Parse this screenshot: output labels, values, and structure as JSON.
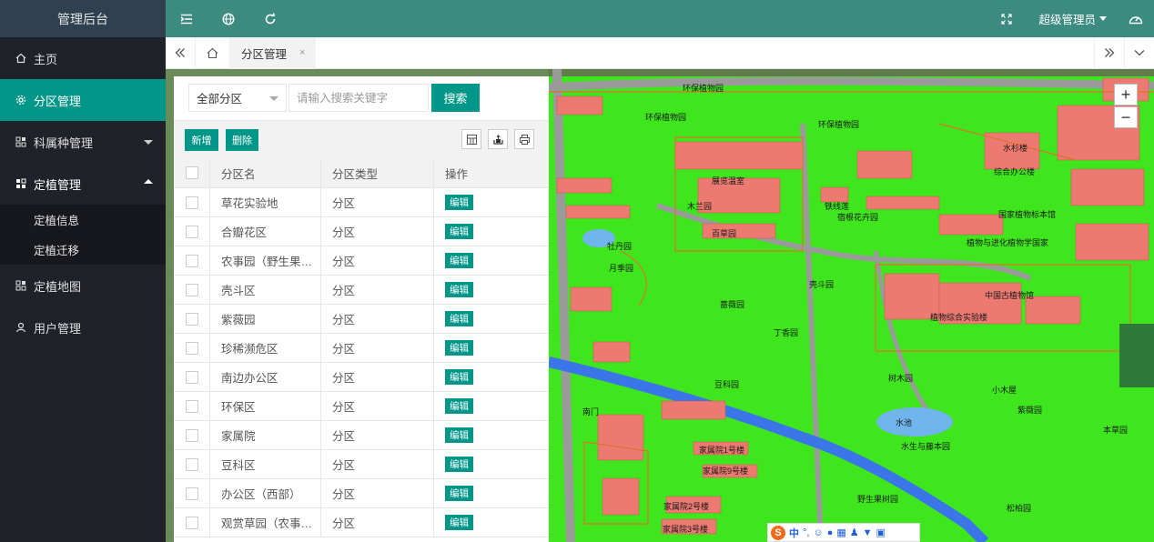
{
  "sidebar": {
    "brand": "管理后台",
    "items": [
      {
        "label": "主页",
        "icon": "home-icon"
      },
      {
        "label": "分区管理",
        "icon": "gear-icon",
        "active": true
      },
      {
        "label": "科属种管理",
        "icon": "apps-icon"
      },
      {
        "label": "定植管理",
        "icon": "apps-icon",
        "expanded": true
      },
      {
        "label": "定植地图",
        "icon": "apps-icon"
      },
      {
        "label": "用户管理",
        "icon": "user-icon"
      }
    ],
    "sub_items": [
      "定植信息",
      "定植迁移"
    ]
  },
  "topbar": {
    "user": "超级管理员",
    "icons": [
      "menu-collapse-icon",
      "globe-icon",
      "refresh-icon",
      "fullscreen-icon",
      "theme-icon"
    ]
  },
  "tabs": {
    "active": "分区管理",
    "close": "×"
  },
  "search": {
    "select_value": "全部分区",
    "placeholder": "请输入搜索关键字",
    "button": "搜索"
  },
  "toolbar": {
    "add": "新增",
    "delete": "删除"
  },
  "table": {
    "headers": [
      "分区名",
      "分区类型",
      "操作"
    ],
    "edit_label": "编辑",
    "rows": [
      {
        "name": "草花实验地",
        "type": "分区"
      },
      {
        "name": "合瓣花区",
        "type": "分区"
      },
      {
        "name": "农事园（野生果…",
        "type": "分区"
      },
      {
        "name": "壳斗区",
        "type": "分区"
      },
      {
        "name": "紫薇园",
        "type": "分区"
      },
      {
        "name": "珍稀濒危区",
        "type": "分区"
      },
      {
        "name": "南边办公区",
        "type": "分区"
      },
      {
        "name": "环保区",
        "type": "分区"
      },
      {
        "name": "家属院",
        "type": "分区"
      },
      {
        "name": "豆科区",
        "type": "分区"
      },
      {
        "name": "办公区（西部）",
        "type": "分区"
      },
      {
        "name": "观赏草园（农事…",
        "type": "分区"
      }
    ]
  },
  "map": {
    "zoom_in": "+",
    "zoom_out": "−",
    "labels": [
      "环保植物园",
      "环保植物园",
      "环保植物园",
      "水杉楼",
      "综合办公楼",
      "展览温室",
      "木兰园",
      "铁线莲",
      "宿根花卉园",
      "百草园",
      "牡丹园",
      "月季园",
      "国家植物标本馆",
      "植物与进化植物学国家",
      "壳斗园",
      "蔷薇园",
      "中国古植物馆",
      "植物综合实验楼",
      "丁香园",
      "树木园",
      "豆科园",
      "小木屋",
      "紫薇园",
      "水池",
      "水生与藤本园",
      "本草园",
      "野生果树园",
      "松柏园",
      "家属院9号楼",
      "家属院1号楼",
      "家属院2号楼",
      "家属院3号楼",
      "南门"
    ]
  },
  "ime": {
    "brand": "S",
    "text": "中"
  }
}
